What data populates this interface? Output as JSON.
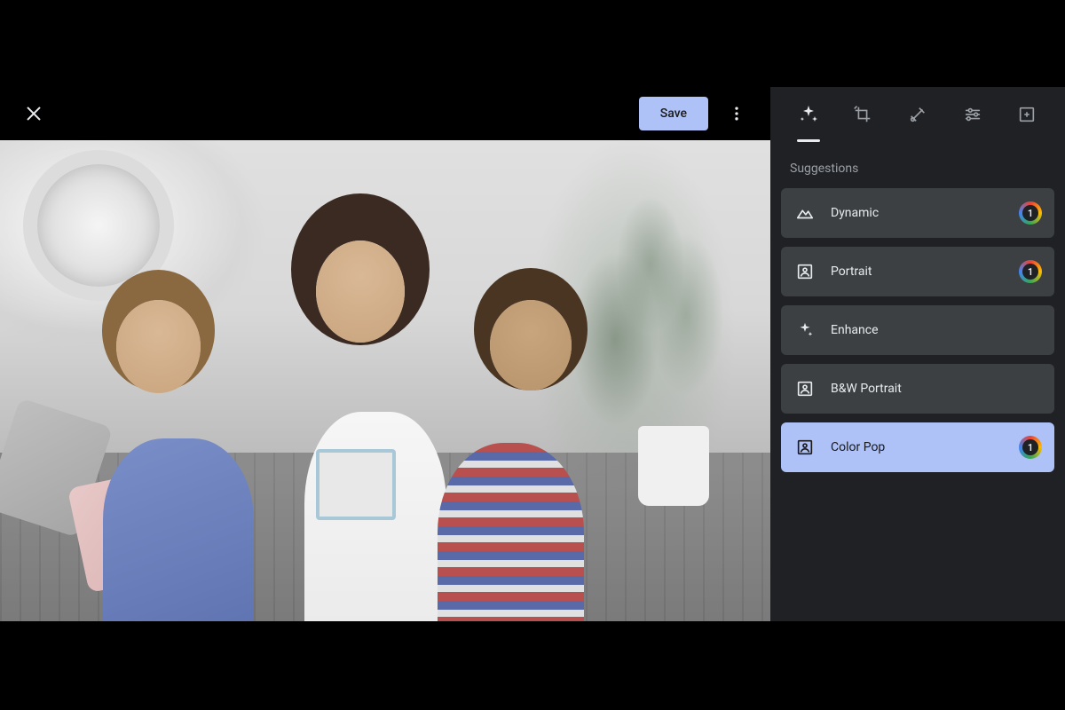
{
  "toolbar": {
    "save_label": "Save"
  },
  "sidebar": {
    "section_title": "Suggestions",
    "suggestions": [
      {
        "label": "Dynamic",
        "icon": "landscape-icon",
        "badge": "1",
        "selected": false
      },
      {
        "label": "Portrait",
        "icon": "portrait-frame-icon",
        "badge": "1",
        "selected": false
      },
      {
        "label": "Enhance",
        "icon": "sparkle-icon",
        "badge": null,
        "selected": false
      },
      {
        "label": "B&W Portrait",
        "icon": "portrait-frame-icon",
        "badge": null,
        "selected": false
      },
      {
        "label": "Color Pop",
        "icon": "portrait-frame-icon",
        "badge": "1",
        "selected": true
      }
    ],
    "tool_tabs": [
      {
        "name": "suggestions",
        "icon": "sparkle-icon",
        "active": true
      },
      {
        "name": "crop",
        "icon": "crop-rotate-icon",
        "active": false
      },
      {
        "name": "tools",
        "icon": "tools-icon",
        "active": false
      },
      {
        "name": "adjust",
        "icon": "sliders-icon",
        "active": false
      },
      {
        "name": "markup",
        "icon": "markup-icon",
        "active": false
      }
    ],
    "badge_label": "1"
  }
}
